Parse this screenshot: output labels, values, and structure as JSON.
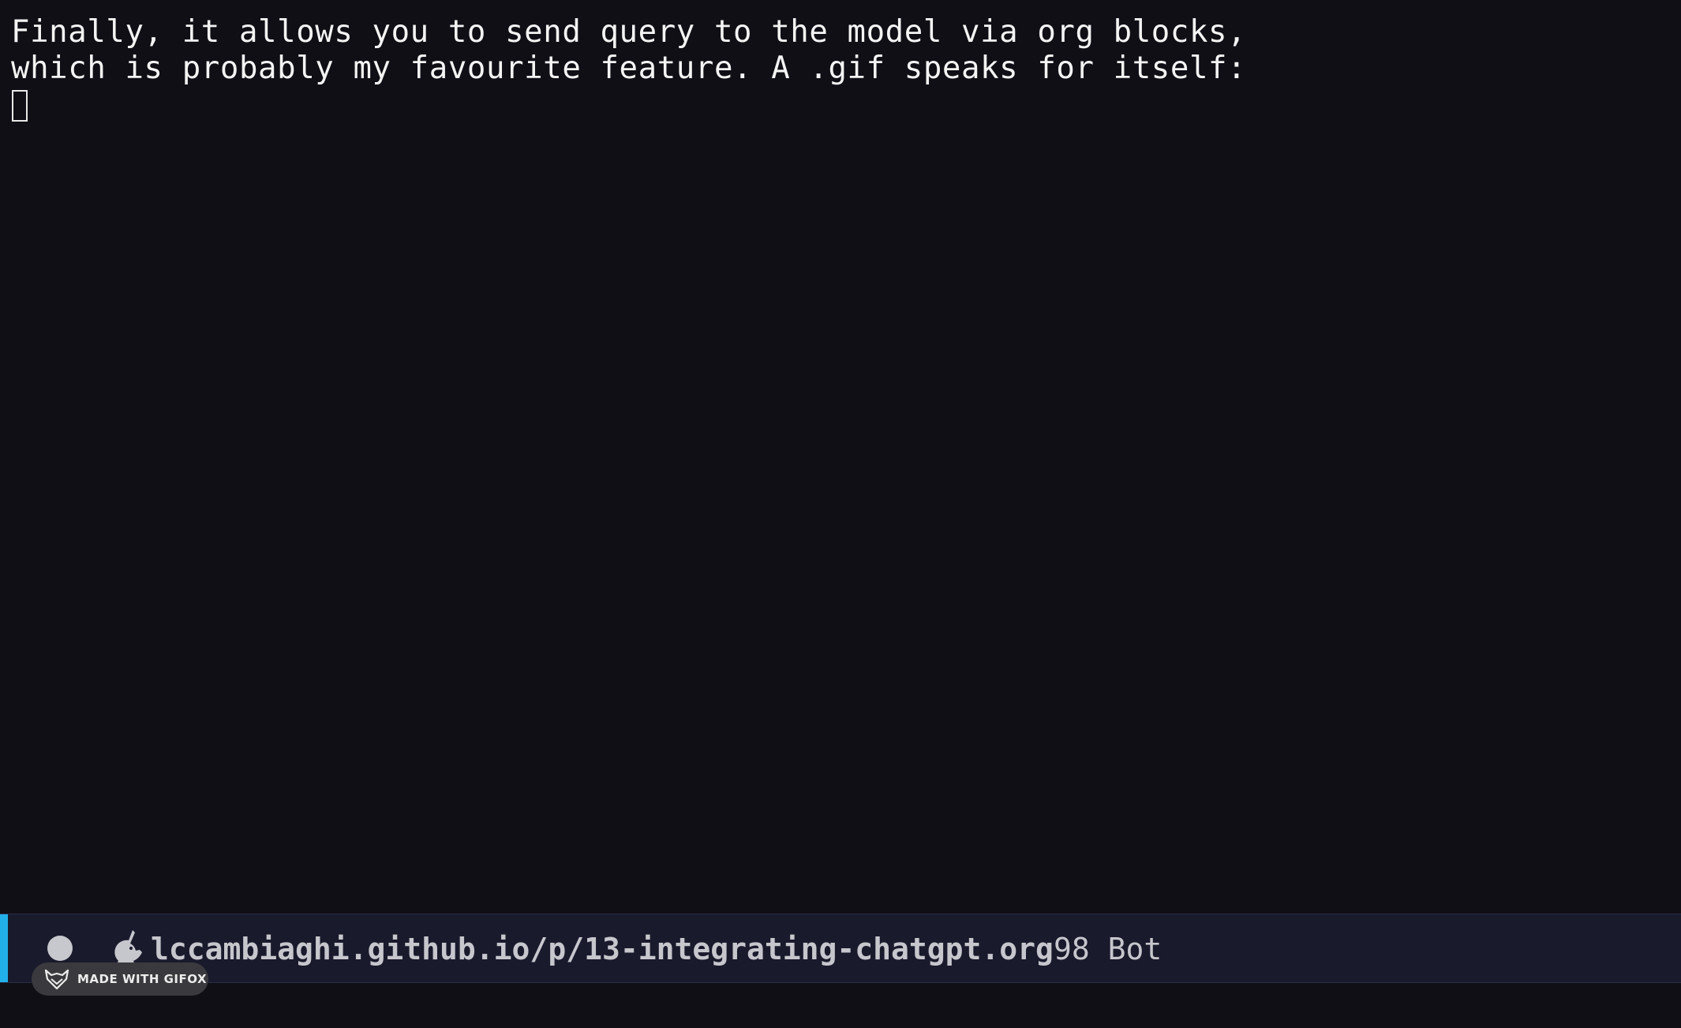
{
  "buffer": {
    "lines": [
      "Finally, it allows you to send query to the model via org blocks,",
      "which is probably my favourite feature. A .gif speaks for itself:"
    ]
  },
  "modeline": {
    "modified_indicator": "circle-icon",
    "mode_icon": "unicorn-icon",
    "file_name": "lccambiaghi.github.io/p/13-integrating-chatgpt.org",
    "position": "98 Bot",
    "accent_color": "#22b0ea",
    "background_color": "#191a2c"
  },
  "watermark": {
    "label": "MADE WITH GIFOX",
    "icon": "fox-icon"
  }
}
